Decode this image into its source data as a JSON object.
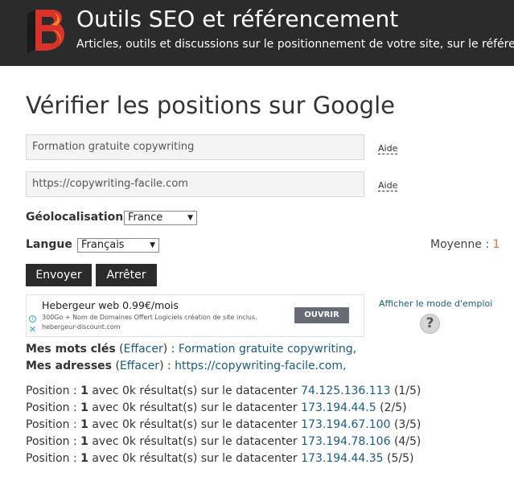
{
  "header": {
    "title": "Outils SEO et référencement",
    "tagline": "Articles, outils et discussions sur le positionnement de votre site, sur le référencement"
  },
  "page": {
    "title": "Vérifier les positions sur Google"
  },
  "form": {
    "keyword_value": "Formation gratuite copywriting",
    "url_value": "https://copywriting-facile.com",
    "aide_label": "Aide",
    "geo_label": "Géolocalisation :",
    "geo_value": "France",
    "langue_label": "Langue :",
    "langue_value": "Français",
    "moyenne_label": "Moyenne :",
    "moyenne_value": "1",
    "send_label": "Envoyer",
    "stop_label": "Arrêter"
  },
  "ad": {
    "title": "Hebergeur web 0.99€/mois",
    "desc": "300Go + Nom de Domaines Offert Logiciels création de site inclus.",
    "url": "hebergeur-discount.com",
    "button": "OUVRIR",
    "info_glyph": "i",
    "close_glyph": "✕"
  },
  "help": {
    "link": "Afficher le mode d'emploi",
    "glyph": "?"
  },
  "saved": {
    "keywords_label": "Mes mots clés",
    "addresses_label": "Mes adresses",
    "open_paren": " (",
    "close_paren_colon": ") : ",
    "clear_label": "Effacer",
    "keywords_value": "Formation gratuite copywriting,",
    "addresses_value": "https://copywriting-facile.com,"
  },
  "results_text": {
    "prefix": "Position : ",
    "middle": " avec 0k résultat(s) sur le datacenter "
  },
  "results": [
    {
      "position": "1",
      "ip": "74.125.136.113",
      "index": "(1/5)"
    },
    {
      "position": "1",
      "ip": "173.194.44.5",
      "index": "(2/5)"
    },
    {
      "position": "1",
      "ip": "173.194.67.100",
      "index": "(3/5)"
    },
    {
      "position": "1",
      "ip": "173.194.78.106",
      "index": "(4/5)"
    },
    {
      "position": "1",
      "ip": "173.194.44.35",
      "index": "(5/5)"
    }
  ],
  "colors": {
    "header_bg": "#2b2b2b",
    "link": "#1a5b85",
    "logo_red": "#d9322b",
    "logo_orange": "#f08a2a",
    "moyenne_value": "#e06a3a"
  }
}
